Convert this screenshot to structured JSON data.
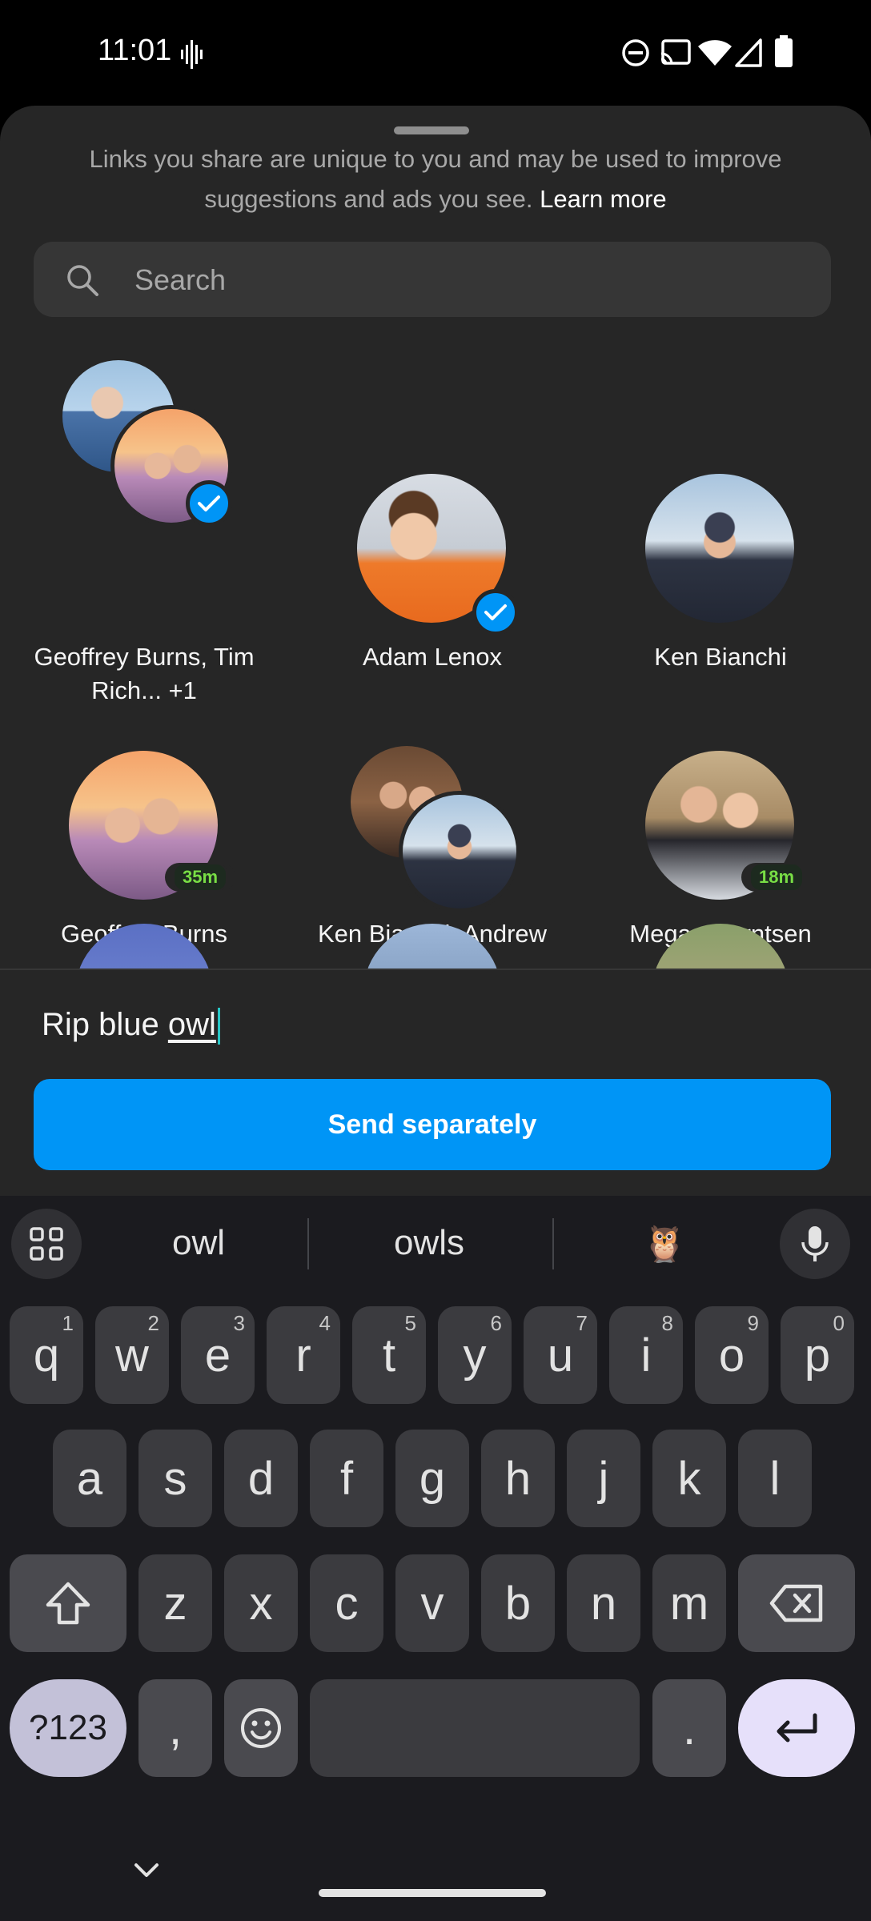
{
  "status_bar": {
    "time": "11:01"
  },
  "share_sheet": {
    "notice": "Links you share are unique to you and may be used to improve suggestions and ads you see.",
    "learn_more": "Learn more",
    "search_placeholder": "Search",
    "contacts": [
      {
        "name": "Geoffrey Burns, Tim Rich... +1",
        "selected": true,
        "group": true
      },
      {
        "name": "Adam Lenox",
        "selected": true,
        "group": false
      },
      {
        "name": "Ken Bianchi",
        "selected": false,
        "group": false
      },
      {
        "name": "Geoffrey Burns",
        "selected": false,
        "group": false,
        "active": "35m"
      },
      {
        "name": "Ken Bianchi, Andrew Beecher",
        "selected": false,
        "group": true
      },
      {
        "name": "Megan Berntsen",
        "selected": false,
        "group": false,
        "active": "18m"
      }
    ]
  },
  "composer": {
    "message_text": "Rip blue ",
    "message_composing": "owl",
    "send_button": "Send separately"
  },
  "keyboard": {
    "suggestions": [
      "owl",
      "owls",
      "🦉"
    ],
    "row1": [
      "q",
      "w",
      "e",
      "r",
      "t",
      "y",
      "u",
      "i",
      "o",
      "p"
    ],
    "row1_hints": [
      "1",
      "2",
      "3",
      "4",
      "5",
      "6",
      "7",
      "8",
      "9",
      "0"
    ],
    "row2": [
      "a",
      "s",
      "d",
      "f",
      "g",
      "h",
      "j",
      "k",
      "l"
    ],
    "row3": [
      "z",
      "x",
      "c",
      "v",
      "b",
      "n",
      "m"
    ],
    "symbols_key": "?123",
    "comma_key": ",",
    "period_key": "."
  },
  "colors": {
    "accent": "#0095f6",
    "background": "#262626",
    "keyboard": "#1b1b1f"
  }
}
